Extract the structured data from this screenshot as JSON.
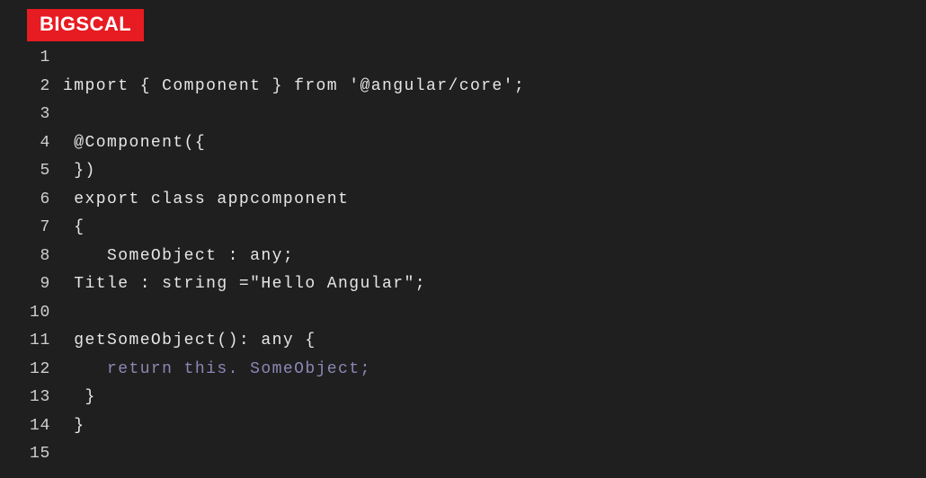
{
  "logo": {
    "text": "BIGSCAL"
  },
  "colors": {
    "accent": "#e71b22",
    "bg": "#1f1f1f",
    "text": "#e6e6e6",
    "muted": "#8b88b5"
  },
  "code": {
    "lines": [
      {
        "n": "1",
        "text": ""
      },
      {
        "n": "2",
        "text": "import { Component } from '@angular/core';"
      },
      {
        "n": "3",
        "text": ""
      },
      {
        "n": "4",
        "text": " @Component({"
      },
      {
        "n": "5",
        "text": " })"
      },
      {
        "n": "6",
        "text": " export class appcomponent"
      },
      {
        "n": "7",
        "text": " {"
      },
      {
        "n": "8",
        "text": "    SomeObject : any;"
      },
      {
        "n": "9",
        "text": " Title : string =\"Hello Angular\";"
      },
      {
        "n": "10",
        "text": ""
      },
      {
        "n": "11",
        "text": " getSomeObject(): any {"
      },
      {
        "n": "12",
        "text": "    ",
        "muted": "return this. SomeObject;"
      },
      {
        "n": "13",
        "text": "  }"
      },
      {
        "n": "14",
        "text": " }"
      },
      {
        "n": "15",
        "text": ""
      }
    ]
  }
}
